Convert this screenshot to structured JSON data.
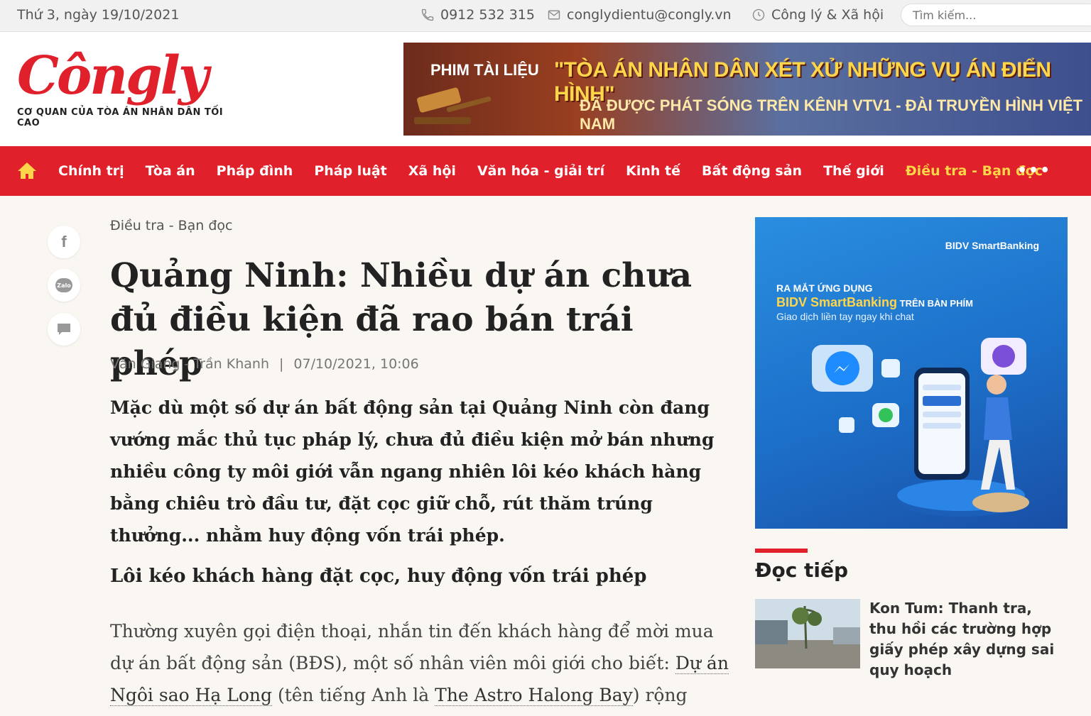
{
  "topbar": {
    "date": "Thứ 3, ngày 19/10/2021",
    "phone": "0912 532 315",
    "email": "conglydientu@congly.vn",
    "brand_link": "Công lý & Xã hội",
    "search_placeholder": "Tìm kiếm..."
  },
  "logo": {
    "name": "Côngly",
    "tagline": "CƠ QUAN CỦA TÒA ÁN NHÂN DÂN TỐI CAO"
  },
  "banner": {
    "kicker": "PHIM TÀI LIỆU",
    "headline": "\"TÒA ÁN NHÂN DÂN XÉT XỬ NHỮNG VỤ ÁN ĐIỂN HÌNH\"",
    "subline": "ĐÃ ĐƯỢC PHÁT SÓNG TRÊN KÊNH VTV1 - ĐÀI TRUYỀN HÌNH VIỆT NAM"
  },
  "nav": {
    "items": [
      {
        "label": "Chính trị"
      },
      {
        "label": "Tòa án"
      },
      {
        "label": "Pháp đình"
      },
      {
        "label": "Pháp luật"
      },
      {
        "label": "Xã hội"
      },
      {
        "label": "Văn hóa - giải trí"
      },
      {
        "label": "Kinh tế"
      },
      {
        "label": "Bất động sản"
      },
      {
        "label": "Thế giới"
      },
      {
        "label": "Điều tra - Bạn đọc"
      }
    ],
    "more": "•••",
    "active_color": "#ffd54a",
    "bar_color": "#e0202a"
  },
  "share": {
    "facebook": "f",
    "zalo": "Zalo"
  },
  "article": {
    "category": "Điều tra - Bạn đọc",
    "title": "Quảng Ninh: Nhiều dự án chưa đủ điều kiện đã rao bán trái phép",
    "author": "Văn Giang - Trần Khanh",
    "separator": "|",
    "datetime": "07/10/2021, 10:06",
    "sapo": "Mặc dù một số dự án bất động sản tại Quảng Ninh còn đang vướng mắc thủ tục pháp lý, chưa đủ điều kiện mở bán nhưng nhiều công ty môi giới vẫn ngang nhiên lôi kéo khách hàng bằng chiêu trò đầu tư, đặt cọc giữ chỗ, rút thăm trúng thưởng... nhằm huy động vốn trái phép.",
    "subheading": "Lôi kéo khách hàng đặt cọc, huy động vốn trái phép",
    "body_part1": "Thường xuyên gọi điện thoại, nhắn tin đến khách hàng để mời mua dự án bất động sản (BĐS), một số nhân viên môi giới cho biết: ",
    "body_link1": "Dự án Ngôi sao Hạ Long",
    "body_part2": " (tên tiếng Anh là ",
    "body_link2": "The Astro Halong Bay",
    "body_part3": ") rộng"
  },
  "ad": {
    "brand": "BIDV SmartBanking",
    "line1": "RA MẮT ỨNG DỤNG",
    "line2_strong": "BIDV SmartBanking",
    "line2_rest": " TRÊN BÀN PHÍM",
    "line3": "Giao dịch liền tay ngay khi chat"
  },
  "read_more": {
    "heading": "Đọc tiếp",
    "item_title": "Kon Tum: Thanh tra, thu hồi các trường hợp giấy phép xây dựng sai quy hoạch"
  }
}
